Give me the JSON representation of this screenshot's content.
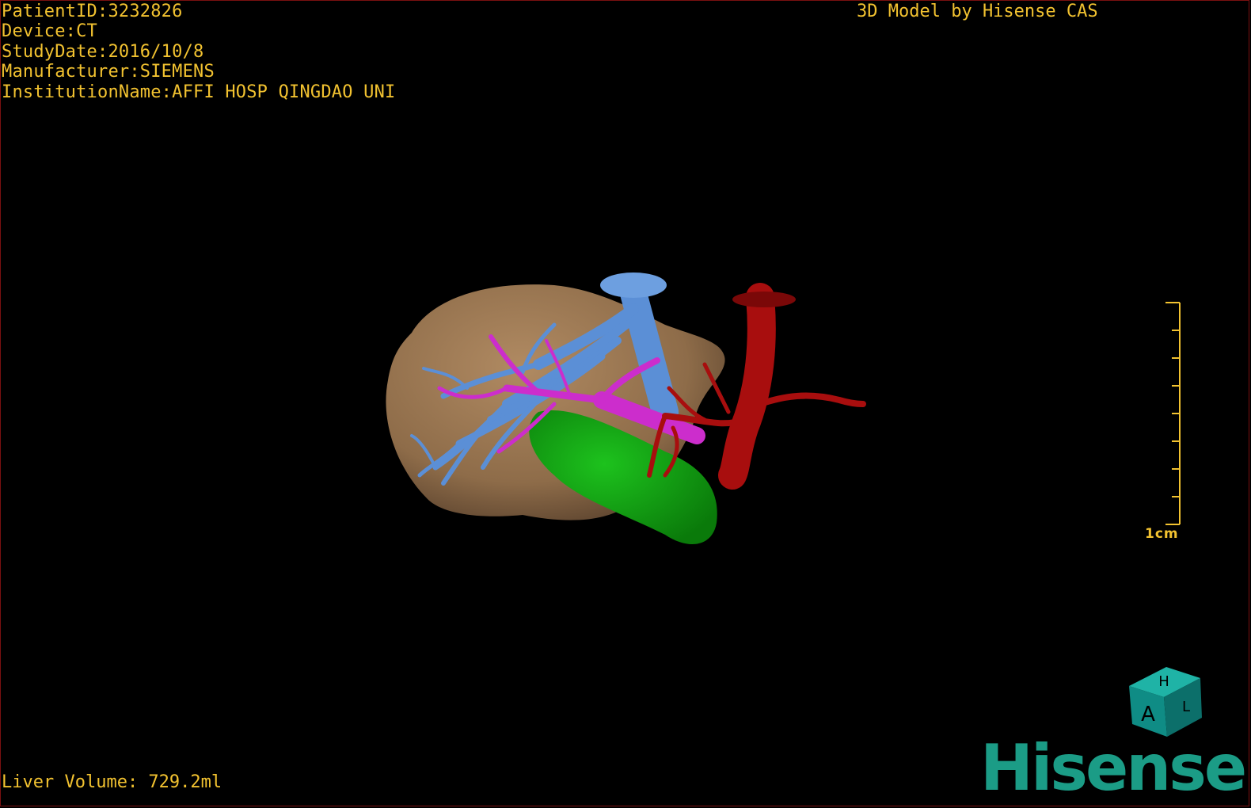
{
  "overlay": {
    "patient_id": "PatientID:3232826",
    "device": "Device:CT",
    "study_date": "StudyDate:2016/10/8",
    "manufacturer": "Manufacturer:SIEMENS",
    "institution": "InstitutionName:AFFI HOSP QINGDAO UNI"
  },
  "header": {
    "model_credit": "3D Model by Hisense CAS"
  },
  "footer": {
    "liver_volume": "Liver Volume: 729.2ml"
  },
  "scale": {
    "label": "1cm"
  },
  "orientation_cube": {
    "top_face": "H",
    "front_face": "A",
    "side_face": "L"
  },
  "brand": {
    "logo_text": "Hisense",
    "color": "#1b9c86"
  },
  "colors": {
    "overlay_text": "#f2c230",
    "liver": "#9c7a56",
    "hepatic_vein": "#5b8fd6",
    "portal_vein": "#cc2dcc",
    "gallbladder": "#10a010",
    "artery": "#a80e0e",
    "background": "#000000"
  },
  "icons": [
    "orientation-cube-icon",
    "scale-bar-icon",
    "hisense-logo"
  ]
}
